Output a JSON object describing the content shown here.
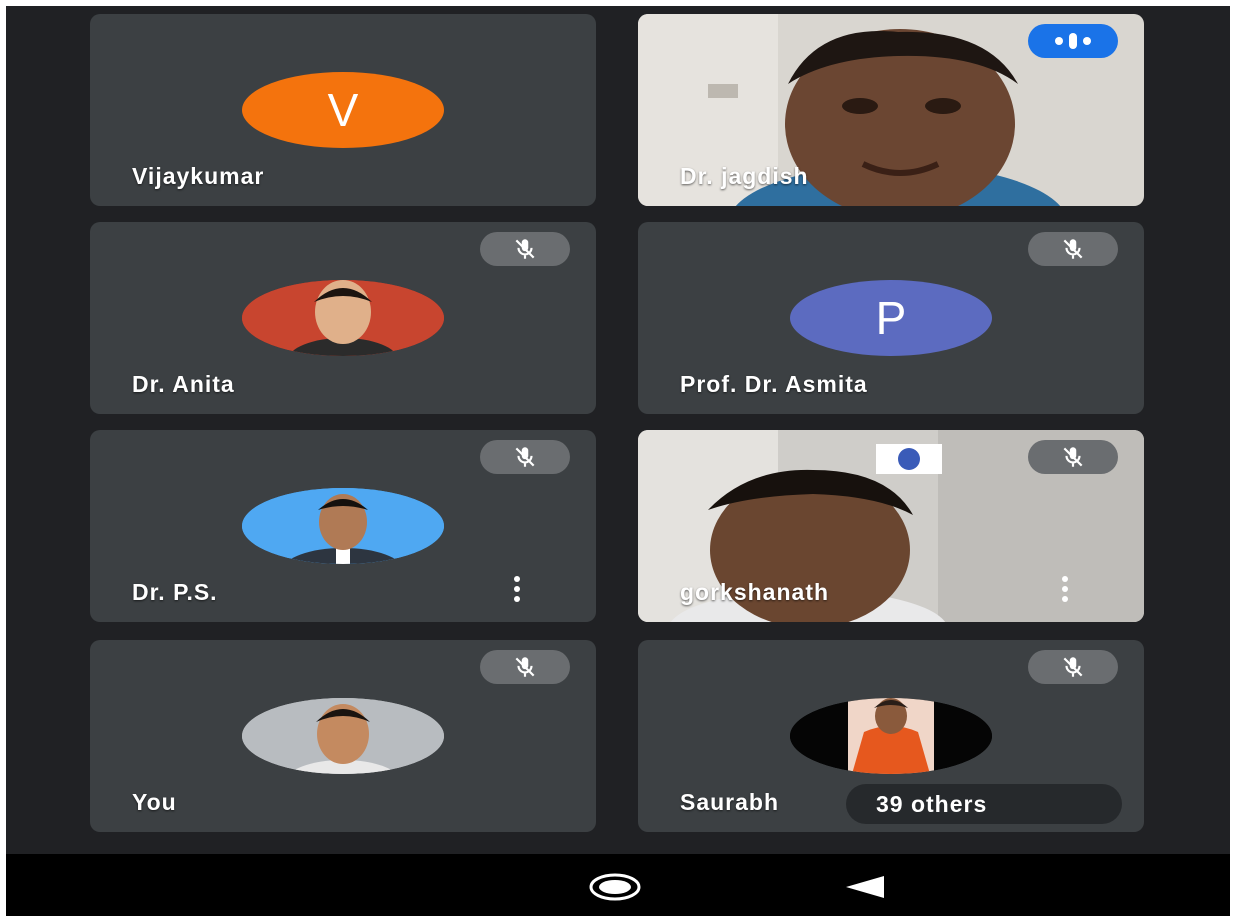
{
  "participants": [
    {
      "name": "Vijaykumar",
      "avatar_letter": "V",
      "avatar_color": "#f4730d",
      "muted": false,
      "speaking": false,
      "video": false
    },
    {
      "name": "Dr. jagdish",
      "muted": false,
      "speaking": true,
      "video": true
    },
    {
      "name": "Dr. Anita",
      "muted": true,
      "video": false,
      "photo": true
    },
    {
      "name": "Prof. Dr. Asmita",
      "avatar_letter": "P",
      "avatar_color": "#5c6bc0",
      "muted": true,
      "video": false
    },
    {
      "name": "Dr. P.S.",
      "muted": true,
      "video": false,
      "photo": true,
      "has_menu": true
    },
    {
      "name": "gorkshanath",
      "muted": true,
      "video": true,
      "has_menu": true
    },
    {
      "name": "You",
      "muted": true,
      "video": false,
      "photo": true
    },
    {
      "name": "Saurabh",
      "muted": true,
      "video": false,
      "photo": true
    }
  ],
  "others": {
    "label": "39 others"
  },
  "icons": {
    "mic_off": "mic-off-icon",
    "speaking": "speaking-indicator-icon",
    "more": "more-vert-icon",
    "home": "home-icon",
    "back": "back-icon"
  },
  "colors": {
    "background": "#202124",
    "tile": "#3c4043",
    "speaking": "#1a73e8"
  }
}
